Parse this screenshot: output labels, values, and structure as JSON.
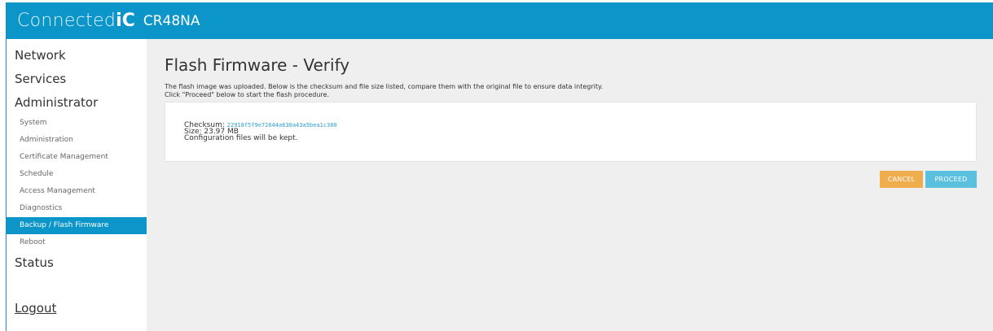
{
  "header": {
    "brand_thin": "Connected",
    "brand_bold": "iC",
    "model": "CR48NA"
  },
  "sidebar": {
    "top_items": [
      "Network",
      "Services",
      "Administrator"
    ],
    "sub_items": [
      "System",
      "Administration",
      "Certificate Management",
      "Schedule",
      "Access Management",
      "Diagnostics",
      "Backup / Flash Firmware",
      "Reboot"
    ],
    "active_sub": "Backup / Flash Firmware",
    "status": "Status",
    "logout": "Logout"
  },
  "main": {
    "title": "Flash Firmware - Verify",
    "description_line1": "The flash image was uploaded. Below is the checksum and file size listed, compare them with the original file to ensure data integrity.",
    "description_line2": "Click \"Proceed\" below to start the flash procedure.",
    "checksum_label": "Checksum:",
    "checksum_value": "22918f5f9e72644a630a43a5bea1c380",
    "size_text": "Size: 23.97 MB",
    "config_text": "Configuration files will be kept.",
    "cancel_label": "CANCEL",
    "proceed_label": "PROCEED"
  },
  "colors": {
    "accent": "#0c95c8",
    "cancel": "#f0ad4e",
    "proceed": "#5bc0de"
  }
}
